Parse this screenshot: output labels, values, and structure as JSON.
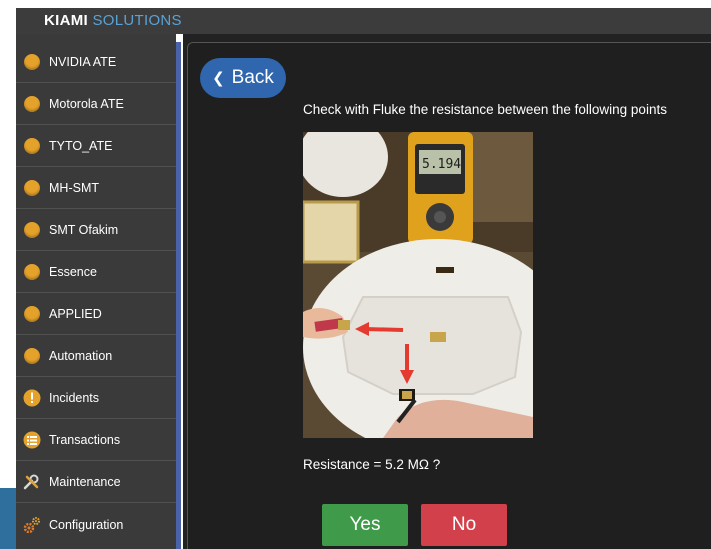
{
  "app": {
    "brand_main": "KIAMI",
    "brand_accent": "SOLUTIONS"
  },
  "sidebar": {
    "items": [
      {
        "label": "NVIDIA ATE",
        "icon": "circle-icon"
      },
      {
        "label": "Motorola ATE",
        "icon": "circle-icon"
      },
      {
        "label": "TYTO_ATE",
        "icon": "circle-icon"
      },
      {
        "label": "MH-SMT",
        "icon": "circle-icon"
      },
      {
        "label": "SMT Ofakim",
        "icon": "circle-icon"
      },
      {
        "label": "Essence",
        "icon": "circle-icon"
      },
      {
        "label": "APPLIED",
        "icon": "circle-icon"
      },
      {
        "label": "Automation",
        "icon": "circle-icon"
      },
      {
        "label": "Incidents",
        "icon": "warning-icon"
      },
      {
        "label": "Transactions",
        "icon": "list-icon"
      },
      {
        "label": "Maintenance",
        "icon": "tools-icon"
      },
      {
        "label": "Configuration",
        "icon": "gears-icon"
      }
    ]
  },
  "main": {
    "back_label": "Back",
    "instruction": "Check with Fluke the resistance between the following points",
    "resistance_text": "Resistance = 5.2 MΩ ?",
    "yes_label": "Yes",
    "no_label": "No",
    "multimeter_reading": "5.194"
  },
  "colors": {
    "accent_blue": "#2f66ad",
    "dot_orange": "#e5a22b",
    "yes_green": "#3f9a4a",
    "no_red": "#d2414b",
    "divider_blue": "#4a62a8"
  }
}
